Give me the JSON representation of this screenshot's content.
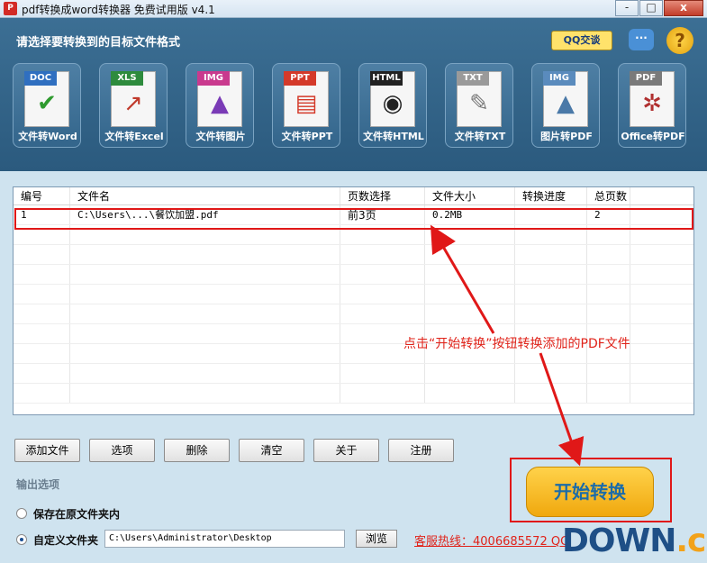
{
  "window": {
    "title": "pdf转换成word转换器 免费试用版 v4.1",
    "app_icon_text": "P",
    "buttons": [
      "-",
      "□",
      "x"
    ]
  },
  "header": {
    "prompt": "请选择要转换到的目标文件格式",
    "qq_label": "QQ交谈",
    "chat_glyph": "···",
    "help_glyph": "?"
  },
  "formats": [
    {
      "tag": "DOC",
      "label": "文件转Word",
      "tag_color": "#2f6fc0",
      "glyph": "✔",
      "glyph_color": "#2e9a2e"
    },
    {
      "tag": "XLS",
      "label": "文件转Excel",
      "tag_color": "#2e8b3d",
      "glyph": "↗",
      "glyph_color": "#c0392b"
    },
    {
      "tag": "IMG",
      "label": "文件转图片",
      "tag_color": "#c93a8e",
      "glyph": "▲",
      "glyph_color": "#7a3bb6"
    },
    {
      "tag": "PPT",
      "label": "文件转PPT",
      "tag_color": "#d43a2a",
      "glyph": "▤",
      "glyph_color": "#d43a2a"
    },
    {
      "tag": "HTML",
      "label": "文件转HTML",
      "tag_color": "#222222",
      "glyph": "◉",
      "glyph_color": "#222222"
    },
    {
      "tag": "TXT",
      "label": "文件转TXT",
      "tag_color": "#9a9a9a",
      "glyph": "✎",
      "glyph_color": "#777777"
    },
    {
      "tag": "IMG",
      "label": "图片转PDF",
      "tag_color": "#5a8bbd",
      "glyph": "▲",
      "glyph_color": "#4a79a8"
    },
    {
      "tag": "PDF",
      "label": "Office转PDF",
      "tag_color": "#7a7a7a",
      "glyph": "✲",
      "glyph_color": "#b03030"
    }
  ],
  "table": {
    "headers": [
      "编号",
      "文件名",
      "页数选择",
      "文件大小",
      "转换进度",
      "总页数"
    ],
    "row": {
      "num": "1",
      "filename": "C:\\Users\\...\\餐饮加盟.pdf",
      "pages": "前3页",
      "size": "0.2MB",
      "progress": "",
      "total": "2"
    }
  },
  "annotation": "点击“开始转换”按钮转换添加的PDF文件",
  "actions": [
    "添加文件",
    "选项",
    "删除",
    "清空",
    "关于",
    "注册"
  ],
  "output": {
    "section_label": "输出选项",
    "option_original": "保存在原文件夹内",
    "option_custom": "自定义文件夹",
    "path": "C:\\Users\\Administrator\\Desktop",
    "browse_label": "浏览",
    "hotline": "客服热线：4006685572 QQ"
  },
  "start_label": "开始转换",
  "watermark": {
    "main": "DOWN",
    "suffix": ".cc"
  },
  "colors": {
    "accent_red": "#e01818",
    "header_blue": "#2b5a7e",
    "start_orange": "#f0a80e"
  }
}
